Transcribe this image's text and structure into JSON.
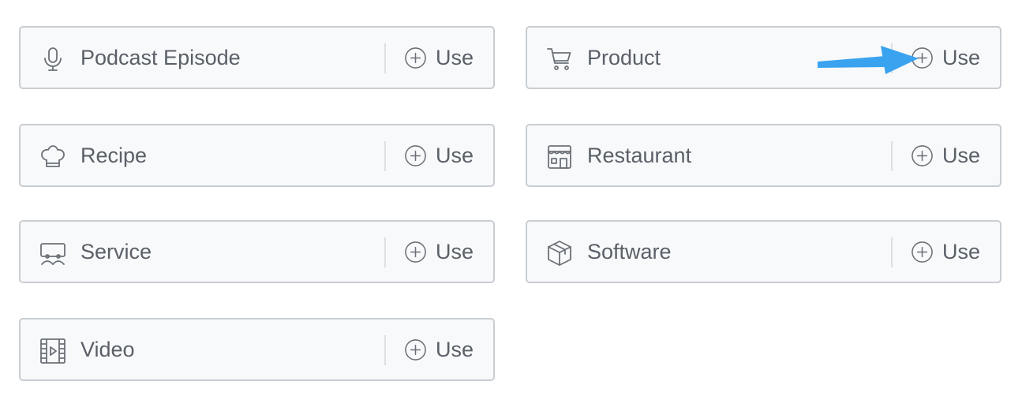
{
  "colors": {
    "card_border": "#c9cdd2",
    "card_background": "#f8f9fa",
    "text": "#5a6068",
    "icon_stroke": "#6b7178",
    "annotation_arrow": "#3aa3f0"
  },
  "schema_types": [
    {
      "label": "Podcast Episode",
      "icon": "microphone-icon",
      "action": "Use"
    },
    {
      "label": "Product",
      "icon": "shopping-cart-icon",
      "action": "Use"
    },
    {
      "label": "Recipe",
      "icon": "chef-hat-icon",
      "action": "Use"
    },
    {
      "label": "Restaurant",
      "icon": "storefront-icon",
      "action": "Use"
    },
    {
      "label": "Service",
      "icon": "service-icon",
      "action": "Use"
    },
    {
      "label": "Software",
      "icon": "software-box-icon",
      "action": "Use"
    },
    {
      "label": "Video",
      "icon": "film-icon",
      "action": "Use"
    }
  ],
  "annotation": {
    "icon": "arrow-annotation-icon"
  }
}
